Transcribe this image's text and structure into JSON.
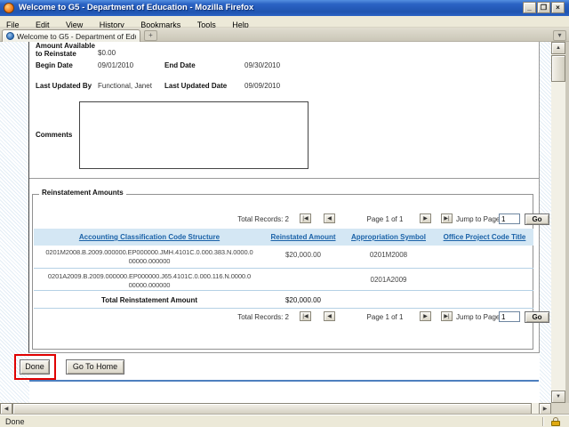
{
  "window": {
    "title": "Welcome to G5 - Department of Education - Mozilla Firefox",
    "controls": {
      "minimize": "_",
      "maximize": "❐",
      "close": "×"
    }
  },
  "menu": {
    "items": [
      "File",
      "Edit",
      "View",
      "History",
      "Bookmarks",
      "Tools",
      "Help"
    ]
  },
  "tabbar": {
    "active_tab_title": "Welcome to G5 - Department of Edu...",
    "new_tab_label": "+",
    "list_tabs_icon": "▾"
  },
  "form": {
    "amount_available_label": "Amount Available to Reinstate",
    "amount_available_value": "$0.00",
    "begin_date_label": "Begin Date",
    "begin_date_value": "09/01/2010",
    "end_date_label": "End Date",
    "end_date_value": "09/30/2010",
    "last_updated_by_label": "Last Updated By",
    "last_updated_by_value": "Functional, Janet",
    "last_updated_date_label": "Last Updated Date",
    "last_updated_date_value": "09/09/2010",
    "comments_label": "Comments",
    "comments_value": ""
  },
  "reinstatement": {
    "legend": "Reinstatement Amounts",
    "pagination": {
      "total_records_label": "Total Records: 2",
      "first_icon": "|◀",
      "prev_icon": "◀",
      "page_label": "Page 1 of 1",
      "next_icon": "▶",
      "last_icon": "▶|",
      "jump_label": "Jump to Page",
      "jump_value": "1",
      "go_label": "Go"
    },
    "table": {
      "headers": [
        "Accounting Classification Code Structure",
        "Reinstated Amount",
        "Appropriation Symbol",
        "Office Project Code Title"
      ],
      "rows": [
        {
          "accs": "0201M2008.B.2009.000000.EP000000.JMH.4101C.0.000.383.N.0000.0 00000.000000",
          "amount": "$20,000.00",
          "symbol": "0201M2008",
          "office_project": ""
        },
        {
          "accs": "0201A2009.B.2009.000000.EP000000.J65.4101C.0.000.116.N.0000.0 00000.000000",
          "amount": "",
          "symbol": "0201A2009",
          "office_project": ""
        }
      ],
      "total_label": "Total Reinstatement Amount",
      "total_value": "$20,000.00"
    }
  },
  "buttons": {
    "done": "Done",
    "go_to_home": "Go To Home"
  },
  "scrollbars": {
    "up": "▲",
    "down": "▼",
    "left": "◀",
    "right": "▶"
  },
  "statusbar": {
    "text": "Done"
  },
  "colors": {
    "titlebar_blue": "#2b63c4",
    "link_blue": "#1a62a8",
    "table_header_bg": "#d4e7f4",
    "row_separator": "#b5d1e5",
    "annotation_red": "#e00000"
  }
}
